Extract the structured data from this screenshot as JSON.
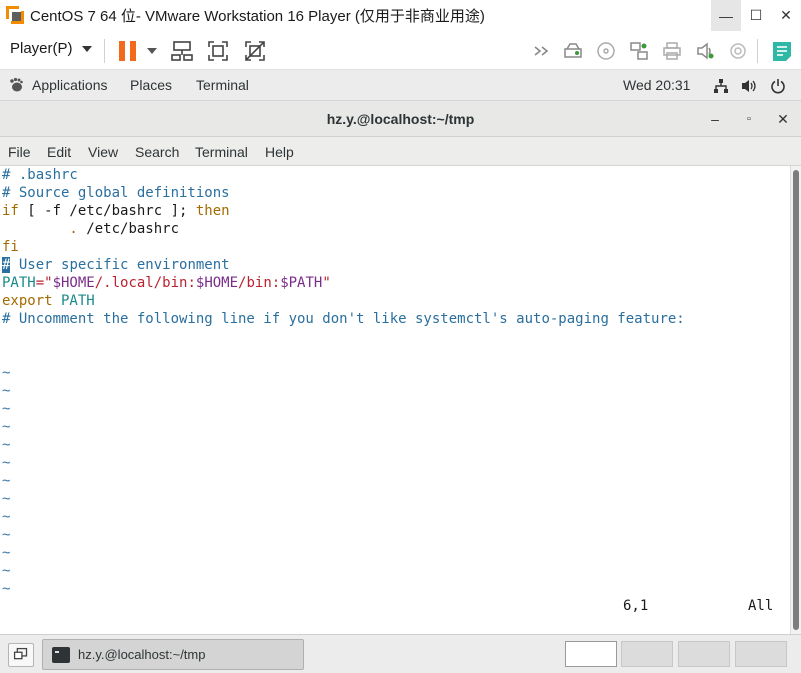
{
  "vmware": {
    "window_title": "CentOS 7 64 位- VMware Workstation 16 Player (仅用于非商业用途)",
    "player_menu": "Player(P)",
    "minimize": "—",
    "maximize": "☐",
    "close": "✕"
  },
  "gnome": {
    "applications": "Applications",
    "places": "Places",
    "terminal": "Terminal",
    "clock": "Wed 20:31"
  },
  "terminal_window": {
    "title": "hz.y.@localhost:~/tmp",
    "minimize": "–",
    "maximize": "▫",
    "close": "✕",
    "menu": {
      "file": "File",
      "edit": "Edit",
      "view": "View",
      "search": "Search",
      "terminal": "Terminal",
      "help": "Help"
    }
  },
  "editor": {
    "lines": {
      "l1": "# .bashrc",
      "l2": "# Source global definitions",
      "l3_if": "if",
      "l3_rest": " [ -f /etc/bashrc ]; ",
      "l3_then": "then",
      "l4_dot": "        . ",
      "l4_path": "/etc/bashrc",
      "l5": "fi",
      "l6_cursor": "#",
      "l6_rest": " User specific environment",
      "l7_var": "PATH",
      "l7_eq": "=\"",
      "l7_home1": "$HOME",
      "l7_mid": "/.local/bin:",
      "l7_home2": "$HOME",
      "l7_mid2": "/bin:",
      "l7_path": "$PATH",
      "l7_end": "\"",
      "l8_kw": "export",
      "l8_var": " PATH",
      "l9": "# Uncomment the following line if you don't like systemctl's auto-paging feature:"
    },
    "tilde": "~",
    "cursor_position": "6,1",
    "scroll_status": "All"
  },
  "taskbar": {
    "task_label": "hz.y.@localhost:~/tmp"
  }
}
